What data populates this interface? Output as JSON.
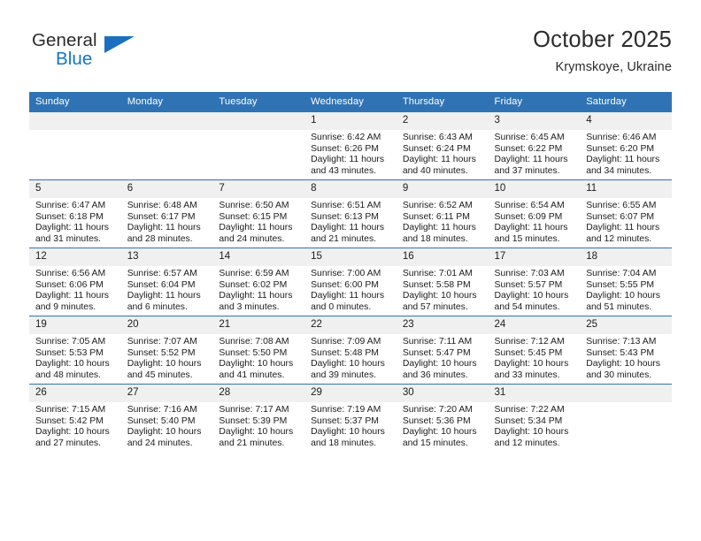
{
  "brand": {
    "name_part1": "General",
    "name_part2": "Blue"
  },
  "header": {
    "title": "October 2025",
    "location": "Krymskoye, Ukraine"
  },
  "colors": {
    "header_blue": "#3073b4",
    "logo_blue": "#1076c4",
    "daynum_band": "#f0f0f0",
    "text": "#1b1b1b"
  },
  "weekday_headers": [
    "Sunday",
    "Monday",
    "Tuesday",
    "Wednesday",
    "Thursday",
    "Friday",
    "Saturday"
  ],
  "weeks": [
    [
      {
        "day": "",
        "sunrise": "",
        "sunset": "",
        "daylight": ""
      },
      {
        "day": "",
        "sunrise": "",
        "sunset": "",
        "daylight": ""
      },
      {
        "day": "",
        "sunrise": "",
        "sunset": "",
        "daylight": ""
      },
      {
        "day": "1",
        "sunrise": "Sunrise: 6:42 AM",
        "sunset": "Sunset: 6:26 PM",
        "daylight": "Daylight: 11 hours and 43 minutes."
      },
      {
        "day": "2",
        "sunrise": "Sunrise: 6:43 AM",
        "sunset": "Sunset: 6:24 PM",
        "daylight": "Daylight: 11 hours and 40 minutes."
      },
      {
        "day": "3",
        "sunrise": "Sunrise: 6:45 AM",
        "sunset": "Sunset: 6:22 PM",
        "daylight": "Daylight: 11 hours and 37 minutes."
      },
      {
        "day": "4",
        "sunrise": "Sunrise: 6:46 AM",
        "sunset": "Sunset: 6:20 PM",
        "daylight": "Daylight: 11 hours and 34 minutes."
      }
    ],
    [
      {
        "day": "5",
        "sunrise": "Sunrise: 6:47 AM",
        "sunset": "Sunset: 6:18 PM",
        "daylight": "Daylight: 11 hours and 31 minutes."
      },
      {
        "day": "6",
        "sunrise": "Sunrise: 6:48 AM",
        "sunset": "Sunset: 6:17 PM",
        "daylight": "Daylight: 11 hours and 28 minutes."
      },
      {
        "day": "7",
        "sunrise": "Sunrise: 6:50 AM",
        "sunset": "Sunset: 6:15 PM",
        "daylight": "Daylight: 11 hours and 24 minutes."
      },
      {
        "day": "8",
        "sunrise": "Sunrise: 6:51 AM",
        "sunset": "Sunset: 6:13 PM",
        "daylight": "Daylight: 11 hours and 21 minutes."
      },
      {
        "day": "9",
        "sunrise": "Sunrise: 6:52 AM",
        "sunset": "Sunset: 6:11 PM",
        "daylight": "Daylight: 11 hours and 18 minutes."
      },
      {
        "day": "10",
        "sunrise": "Sunrise: 6:54 AM",
        "sunset": "Sunset: 6:09 PM",
        "daylight": "Daylight: 11 hours and 15 minutes."
      },
      {
        "day": "11",
        "sunrise": "Sunrise: 6:55 AM",
        "sunset": "Sunset: 6:07 PM",
        "daylight": "Daylight: 11 hours and 12 minutes."
      }
    ],
    [
      {
        "day": "12",
        "sunrise": "Sunrise: 6:56 AM",
        "sunset": "Sunset: 6:06 PM",
        "daylight": "Daylight: 11 hours and 9 minutes."
      },
      {
        "day": "13",
        "sunrise": "Sunrise: 6:57 AM",
        "sunset": "Sunset: 6:04 PM",
        "daylight": "Daylight: 11 hours and 6 minutes."
      },
      {
        "day": "14",
        "sunrise": "Sunrise: 6:59 AM",
        "sunset": "Sunset: 6:02 PM",
        "daylight": "Daylight: 11 hours and 3 minutes."
      },
      {
        "day": "15",
        "sunrise": "Sunrise: 7:00 AM",
        "sunset": "Sunset: 6:00 PM",
        "daylight": "Daylight: 11 hours and 0 minutes."
      },
      {
        "day": "16",
        "sunrise": "Sunrise: 7:01 AM",
        "sunset": "Sunset: 5:58 PM",
        "daylight": "Daylight: 10 hours and 57 minutes."
      },
      {
        "day": "17",
        "sunrise": "Sunrise: 7:03 AM",
        "sunset": "Sunset: 5:57 PM",
        "daylight": "Daylight: 10 hours and 54 minutes."
      },
      {
        "day": "18",
        "sunrise": "Sunrise: 7:04 AM",
        "sunset": "Sunset: 5:55 PM",
        "daylight": "Daylight: 10 hours and 51 minutes."
      }
    ],
    [
      {
        "day": "19",
        "sunrise": "Sunrise: 7:05 AM",
        "sunset": "Sunset: 5:53 PM",
        "daylight": "Daylight: 10 hours and 48 minutes."
      },
      {
        "day": "20",
        "sunrise": "Sunrise: 7:07 AM",
        "sunset": "Sunset: 5:52 PM",
        "daylight": "Daylight: 10 hours and 45 minutes."
      },
      {
        "day": "21",
        "sunrise": "Sunrise: 7:08 AM",
        "sunset": "Sunset: 5:50 PM",
        "daylight": "Daylight: 10 hours and 41 minutes."
      },
      {
        "day": "22",
        "sunrise": "Sunrise: 7:09 AM",
        "sunset": "Sunset: 5:48 PM",
        "daylight": "Daylight: 10 hours and 39 minutes."
      },
      {
        "day": "23",
        "sunrise": "Sunrise: 7:11 AM",
        "sunset": "Sunset: 5:47 PM",
        "daylight": "Daylight: 10 hours and 36 minutes."
      },
      {
        "day": "24",
        "sunrise": "Sunrise: 7:12 AM",
        "sunset": "Sunset: 5:45 PM",
        "daylight": "Daylight: 10 hours and 33 minutes."
      },
      {
        "day": "25",
        "sunrise": "Sunrise: 7:13 AM",
        "sunset": "Sunset: 5:43 PM",
        "daylight": "Daylight: 10 hours and 30 minutes."
      }
    ],
    [
      {
        "day": "26",
        "sunrise": "Sunrise: 7:15 AM",
        "sunset": "Sunset: 5:42 PM",
        "daylight": "Daylight: 10 hours and 27 minutes."
      },
      {
        "day": "27",
        "sunrise": "Sunrise: 7:16 AM",
        "sunset": "Sunset: 5:40 PM",
        "daylight": "Daylight: 10 hours and 24 minutes."
      },
      {
        "day": "28",
        "sunrise": "Sunrise: 7:17 AM",
        "sunset": "Sunset: 5:39 PM",
        "daylight": "Daylight: 10 hours and 21 minutes."
      },
      {
        "day": "29",
        "sunrise": "Sunrise: 7:19 AM",
        "sunset": "Sunset: 5:37 PM",
        "daylight": "Daylight: 10 hours and 18 minutes."
      },
      {
        "day": "30",
        "sunrise": "Sunrise: 7:20 AM",
        "sunset": "Sunset: 5:36 PM",
        "daylight": "Daylight: 10 hours and 15 minutes."
      },
      {
        "day": "31",
        "sunrise": "Sunrise: 7:22 AM",
        "sunset": "Sunset: 5:34 PM",
        "daylight": "Daylight: 10 hours and 12 minutes."
      },
      {
        "day": "",
        "sunrise": "",
        "sunset": "",
        "daylight": ""
      }
    ]
  ]
}
